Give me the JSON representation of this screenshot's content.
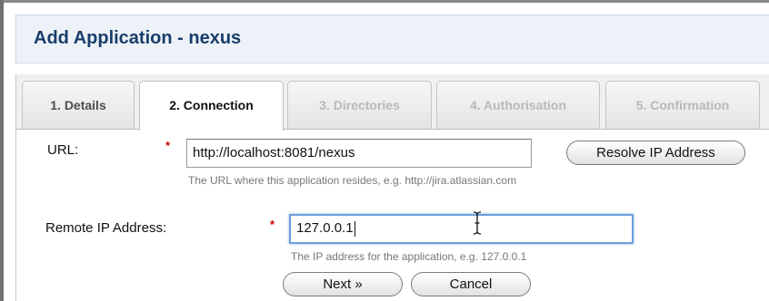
{
  "header": {
    "title": "Add Application - nexus"
  },
  "tabs": [
    {
      "label": "1. Details",
      "state": "done"
    },
    {
      "label": "2. Connection",
      "state": "active"
    },
    {
      "label": "3. Directories",
      "state": "disabled"
    },
    {
      "label": "4. Authorisation",
      "state": "disabled"
    },
    {
      "label": "5. Confirmation",
      "state": "disabled"
    }
  ],
  "form": {
    "url": {
      "label": "URL:",
      "required_marker": "*",
      "value": "http://localhost:8081/nexus",
      "hint": "The URL where this application resides, e.g. http://jira.atlassian.com",
      "resolve_button": "Resolve IP Address"
    },
    "remote_ip": {
      "label": "Remote IP Address:",
      "required_marker": "*",
      "value": "127.0.0.1",
      "hint": "The IP address for the application, e.g. 127.0.0.1"
    }
  },
  "buttons": {
    "next": "Next »",
    "cancel": "Cancel"
  },
  "colors": {
    "title": "#183d6b",
    "header_bg": "#edf2f8",
    "required": "#cc0000",
    "focus_ring": "#6d9fd8"
  },
  "cursor": "text-ibeam-cursor"
}
